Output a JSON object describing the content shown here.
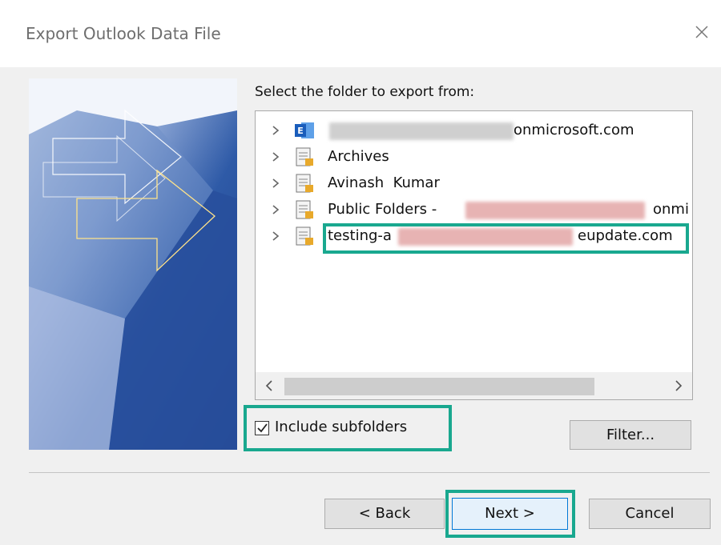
{
  "dialog": {
    "title": "Export Outlook Data File",
    "prompt": "Select the folder to export from:"
  },
  "tree": {
    "items": [
      {
        "label": "onmicrosoft.com",
        "icon": "exchange-account-icon",
        "redacted_prefix": true
      },
      {
        "label": "Archives",
        "icon": "pst-file-icon"
      },
      {
        "label": "Avinash  Kumar",
        "icon": "pst-file-icon"
      },
      {
        "label": "Public Folders -",
        "suffix": "onmi",
        "icon": "pst-file-icon",
        "redacted_middle": true
      },
      {
        "label": "testing-a",
        "suffix": "eupdate.com",
        "icon": "pst-file-icon",
        "redacted_middle": true,
        "highlighted": true
      }
    ]
  },
  "options": {
    "include_subfolders_label": "Include subfolders",
    "include_subfolders_checked": true
  },
  "buttons": {
    "filter": "Filter...",
    "back": "< Back",
    "next": "Next >",
    "cancel": "Cancel"
  },
  "colors": {
    "highlight": "#19a88f",
    "exchange_blue": "#1a5dbb"
  }
}
